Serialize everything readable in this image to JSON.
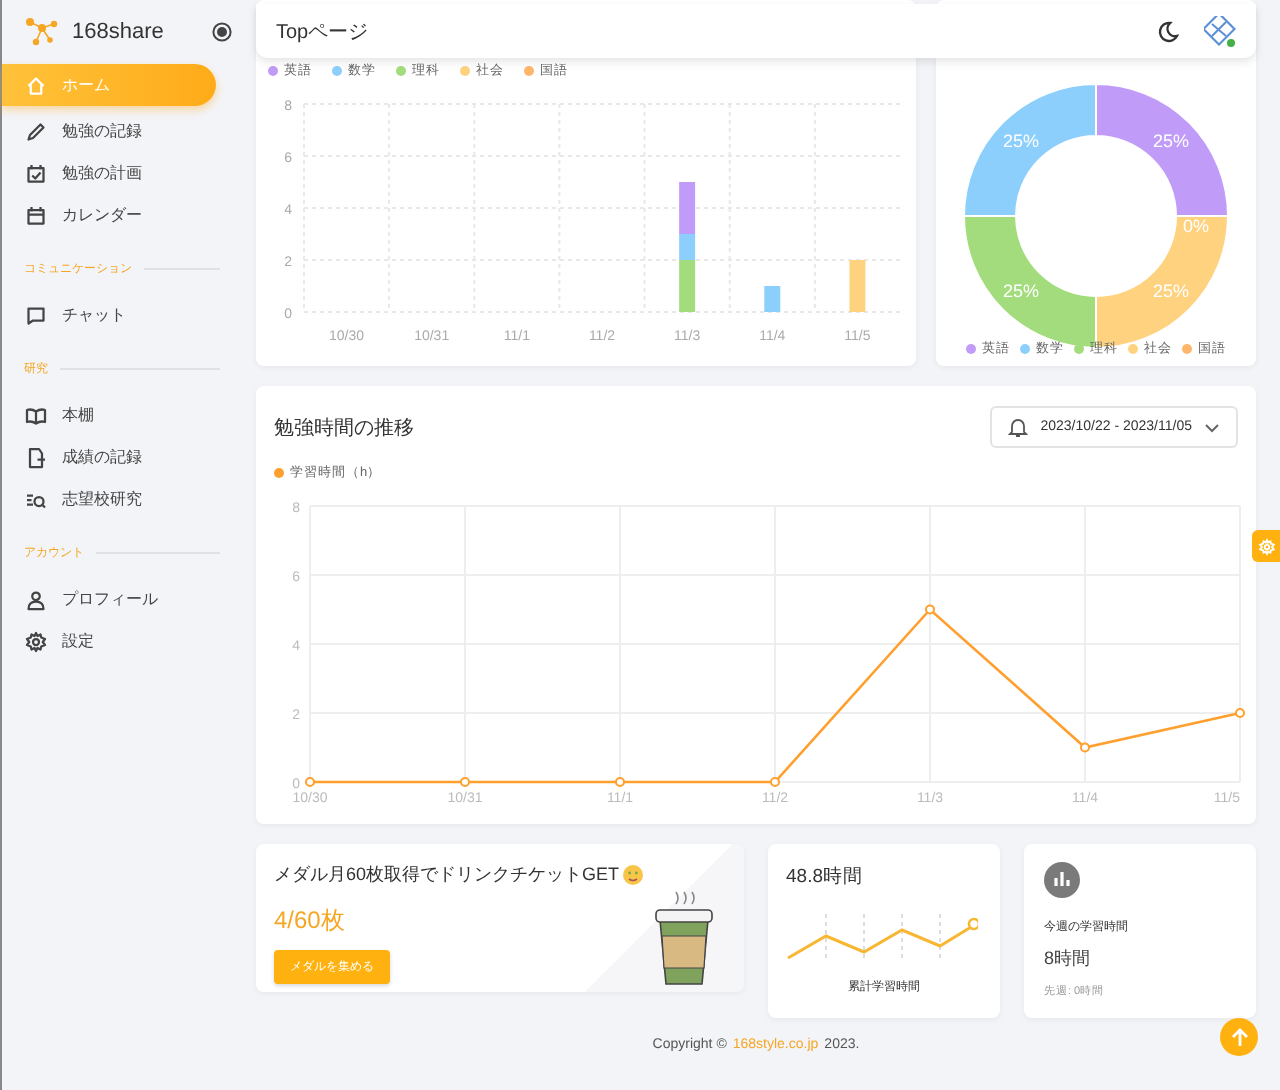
{
  "header": {
    "title": "Topページ"
  },
  "sidebar": {
    "logo": "168share",
    "sections": [
      {
        "items": [
          {
            "label": "ホーム",
            "selected": true
          },
          {
            "label": "勉強の記録",
            "selected": false
          },
          {
            "label": "勉強の計画",
            "selected": false
          },
          {
            "label": "カレンダー",
            "selected": false
          }
        ]
      },
      {
        "heading": "コミュニケーション",
        "items": [
          {
            "label": "チャット",
            "selected": false
          }
        ]
      },
      {
        "heading": "研究",
        "items": [
          {
            "label": "本棚",
            "selected": false
          },
          {
            "label": "成績の記録",
            "selected": false
          },
          {
            "label": "志望校研究",
            "selected": false
          }
        ]
      },
      {
        "heading": "アカウント",
        "items": [
          {
            "label": "プロフィール",
            "selected": false
          },
          {
            "label": "設定",
            "selected": false
          }
        ]
      }
    ]
  },
  "subject_chart": {
    "chart_data": {
      "type": "bar",
      "stacked": true,
      "grid": true,
      "categories": [
        "10/30",
        "10/31",
        "11/1",
        "11/2",
        "11/3",
        "11/4",
        "11/5"
      ],
      "yticks": [
        0,
        2,
        4,
        6,
        8
      ],
      "ylim": [
        0,
        8
      ],
      "series": [
        {
          "name": "英語",
          "color": "#c09cf8",
          "values": [
            0,
            0,
            0,
            0,
            2,
            0,
            0
          ]
        },
        {
          "name": "数学",
          "color": "#8dcffc",
          "values": [
            0,
            0,
            0,
            0,
            1,
            1,
            0
          ]
        },
        {
          "name": "理科",
          "color": "#a3dc7c",
          "values": [
            0,
            0,
            0,
            0,
            2,
            0,
            0
          ]
        },
        {
          "name": "社会",
          "color": "#ffd27f",
          "values": [
            0,
            0,
            0,
            0,
            0,
            0,
            2
          ]
        },
        {
          "name": "国語",
          "color": "#ffb56b",
          "values": [
            0,
            0,
            0,
            0,
            0,
            0,
            0
          ]
        }
      ]
    }
  },
  "subject_share": {
    "chart_data": {
      "type": "donut",
      "categories": [
        "英語",
        "数学",
        "理科",
        "社会",
        "国語"
      ],
      "values": [
        25,
        25,
        25,
        25,
        0
      ],
      "value_labels": [
        "25%",
        "25%",
        "25%",
        "25%",
        "0%"
      ],
      "colors": [
        "#c09cf8",
        "#8dcffc",
        "#a3dc7c",
        "#ffd27f",
        "#ffb56b"
      ]
    }
  },
  "trend": {
    "title": "勉強時間の推移",
    "date_range": "2023/10/22 - 2023/11/05",
    "chart_data": {
      "type": "line",
      "grid": true,
      "categories": [
        "10/30",
        "10/31",
        "11/1",
        "11/2",
        "11/3",
        "11/4",
        "11/5"
      ],
      "yticks": [
        0,
        2,
        4,
        6,
        8
      ],
      "ylim": [
        0,
        8
      ],
      "series": [
        {
          "name": "学習時間（h）",
          "color": "#ff9f2e",
          "marker": "circle",
          "values": [
            0,
            0,
            0,
            0,
            5,
            1,
            2
          ]
        }
      ]
    }
  },
  "medal": {
    "title": "メダル月60枚取得でドリンクチケットGET",
    "count": "4/60枚",
    "button": "メダルを集める"
  },
  "total": {
    "value": "48.8時間",
    "label": "累計学習時間"
  },
  "week": {
    "label": "今週の学習時間",
    "value": "8時間",
    "previous": "先週: 0時間"
  },
  "footer": {
    "prefix": "Copyright ©",
    "link": "168style.co.jp",
    "suffix": "2023."
  }
}
